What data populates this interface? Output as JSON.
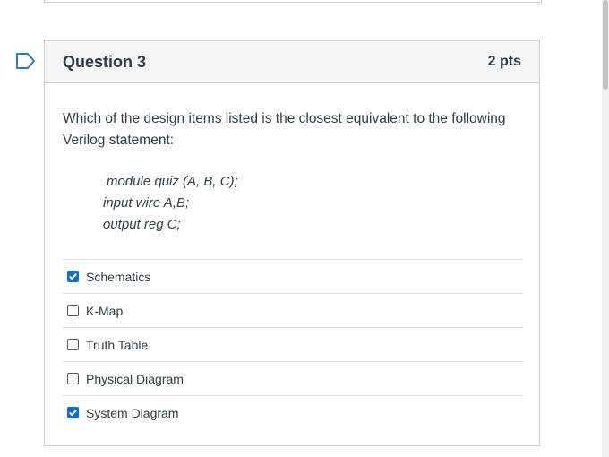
{
  "question": {
    "title": "Question 3",
    "points": "2 pts",
    "text": "Which of the design items listed is the closest equivalent to the following Verilog statement:",
    "code": [
      "module quiz (A, B, C);",
      "input wire A,B;",
      "output reg C;"
    ],
    "answers": [
      {
        "label": "Schematics",
        "checked": true
      },
      {
        "label": "K-Map",
        "checked": false
      },
      {
        "label": "Truth Table",
        "checked": false
      },
      {
        "label": "Physical Diagram",
        "checked": false
      },
      {
        "label": "System Diagram",
        "checked": true
      }
    ]
  },
  "colors": {
    "accent": "#0a6fd6",
    "flag": "#2b7abc",
    "border": "#c7cdd1",
    "header_bg": "#f5f5f5",
    "text": "#2d3b45"
  },
  "icons": {
    "flag": "flag-question-icon",
    "check": "checkmark-icon"
  }
}
